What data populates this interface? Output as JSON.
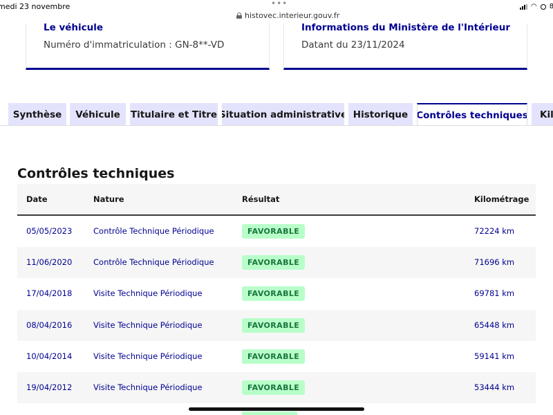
{
  "status_bar": {
    "date": "medi 23 novembre",
    "dots": "•••",
    "url": "histovec.interieur.gouv.fr",
    "battery": "8"
  },
  "cards": {
    "vehicle": {
      "title": "Le véhicule",
      "text": "Numéro d'immatriculation : GN-8**-VD"
    },
    "ministry": {
      "title": "Informations du Ministère de l'Intérieur",
      "text": "Datant du 23/11/2024"
    }
  },
  "tabs": [
    {
      "label": "Synthèse"
    },
    {
      "label": "Véhicule"
    },
    {
      "label": "Titulaire et Titre"
    },
    {
      "label": "Situation administrative"
    },
    {
      "label": "Historique"
    },
    {
      "label": "Contrôles techniques",
      "active": true
    },
    {
      "label": "Kilo"
    }
  ],
  "section": {
    "title": "Contrôles techniques"
  },
  "table": {
    "headers": [
      "Date",
      "Nature",
      "Résultat",
      "Kilométrage"
    ],
    "rows": [
      {
        "date": "05/05/2023",
        "nature": "Contrôle Technique Périodique",
        "result": "FAVORABLE",
        "km": "72224 km"
      },
      {
        "date": "11/06/2020",
        "nature": "Contrôle Technique Périodique",
        "result": "FAVORABLE",
        "km": "71696 km"
      },
      {
        "date": "17/04/2018",
        "nature": "Visite Technique Périodique",
        "result": "FAVORABLE",
        "km": "69781 km"
      },
      {
        "date": "08/04/2016",
        "nature": "Visite Technique Périodique",
        "result": "FAVORABLE",
        "km": "65448 km"
      },
      {
        "date": "10/04/2014",
        "nature": "Visite Technique Périodique",
        "result": "FAVORABLE",
        "km": "59141 km"
      },
      {
        "date": "19/04/2012",
        "nature": "Visite Technique Périodique",
        "result": "FAVORABLE",
        "km": "53444 km"
      }
    ]
  },
  "colors": {
    "accent": "#000091",
    "tab_bg": "#e3e3fd",
    "badge_bg": "#b8fec9",
    "badge_text": "#18753c"
  }
}
